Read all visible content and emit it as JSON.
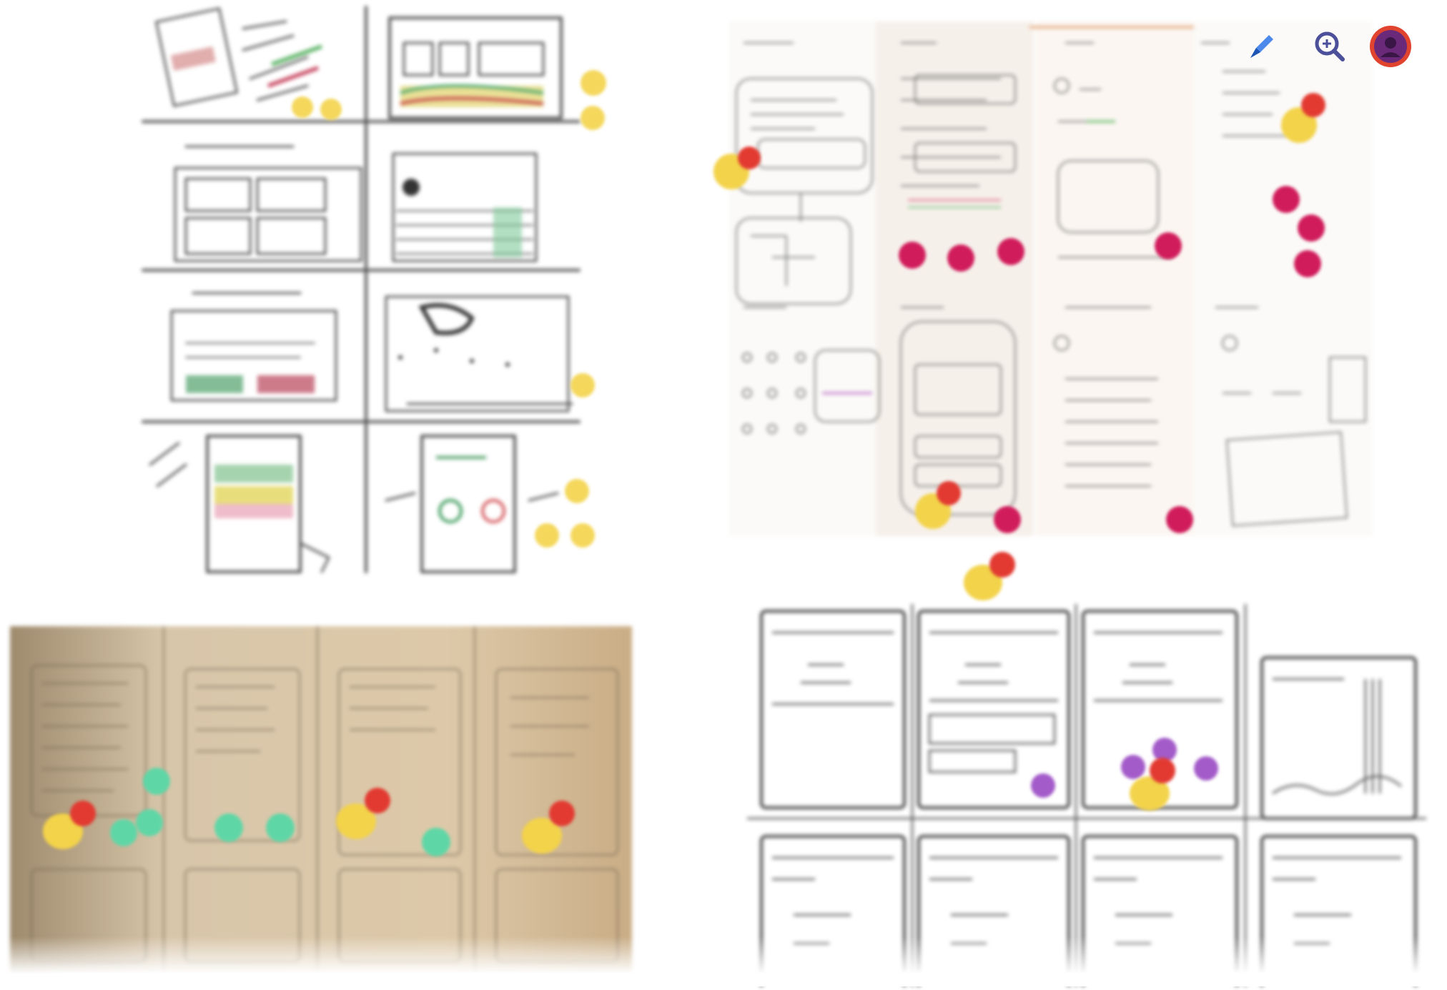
{
  "colors": {
    "background": "#ffffff",
    "vote_yellow": "#f3d34a",
    "vote_red": "#e23a31",
    "vote_magenta": "#d01c5b",
    "vote_green": "#5fd6a6",
    "vote_purple": "#a35bc9",
    "paper_tan": "#c9ad86",
    "accent_blue": "#2d74e8"
  },
  "toolbar": {
    "pen_icon": "pen-icon",
    "zoom_icon": "zoom-icon",
    "avatar_icon": "user-avatar"
  }
}
